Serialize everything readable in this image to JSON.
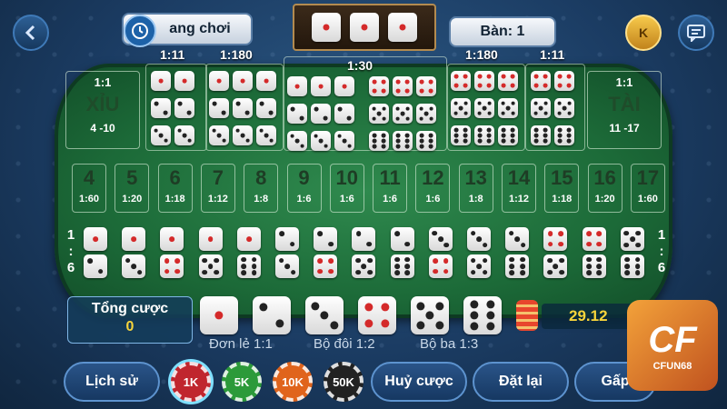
{
  "header": {
    "back_icon": "chevron-left-icon",
    "game_rules_label": "ang chơi",
    "table_label": "Bàn: 1",
    "coin_icon": "k-coin-icon",
    "chat_icon": "chat-icon"
  },
  "result_dice": [
    1,
    1,
    1
  ],
  "odds": {
    "single_triple": "1:11",
    "double_pair_left": "1:180",
    "any_triple": "1:30",
    "double_pair_right": "1:180",
    "single_triple_right": "1:11"
  },
  "small": {
    "ratio": "1:1",
    "label": "XỈU",
    "range": "4 -10"
  },
  "big": {
    "ratio": "1:1",
    "label": "TÀI",
    "range": "11 -17"
  },
  "sums": [
    {
      "n": "4",
      "r": "1:60"
    },
    {
      "n": "5",
      "r": "1:20"
    },
    {
      "n": "6",
      "r": "1:18"
    },
    {
      "n": "7",
      "r": "1:12"
    },
    {
      "n": "8",
      "r": "1:8"
    },
    {
      "n": "9",
      "r": "1:6"
    },
    {
      "n": "10",
      "r": "1:6"
    },
    {
      "n": "11",
      "r": "1:6"
    },
    {
      "n": "12",
      "r": "1:6"
    },
    {
      "n": "13",
      "r": "1:8"
    },
    {
      "n": "14",
      "r": "1:12"
    },
    {
      "n": "15",
      "r": "1:18"
    },
    {
      "n": "16",
      "r": "1:20"
    },
    {
      "n": "17",
      "r": "1:60"
    }
  ],
  "combo_odds_left": [
    "1",
    ":",
    "6"
  ],
  "combo_odds_right": [
    "1",
    ":",
    "6"
  ],
  "combos": [
    [
      1,
      2
    ],
    [
      1,
      3
    ],
    [
      1,
      4
    ],
    [
      1,
      5
    ],
    [
      1,
      6
    ],
    [
      2,
      3
    ],
    [
      2,
      4
    ],
    [
      2,
      5
    ],
    [
      2,
      6
    ],
    [
      3,
      4
    ],
    [
      3,
      5
    ],
    [
      3,
      6
    ],
    [
      4,
      5
    ],
    [
      4,
      6
    ],
    [
      5,
      6
    ]
  ],
  "total_bet": {
    "label": "Tổng cược",
    "value": "0"
  },
  "singles": [
    1,
    2,
    3,
    4,
    5,
    6
  ],
  "balance": "29.12",
  "legend": {
    "single": "Đơn lẻ 1:1",
    "double": "Bộ đôi 1:2",
    "triple": "Bộ ba 1:3"
  },
  "buttons": {
    "history": "Lịch sử",
    "cancel": "Huỷ cược",
    "reset": "Đặt lại",
    "double": "Gấp"
  },
  "chips": [
    {
      "label": "1K",
      "color": "#c0262e"
    },
    {
      "label": "5K",
      "color": "#2c9a3a"
    },
    {
      "label": "10K",
      "color": "#e0641c"
    },
    {
      "label": "50K",
      "color": "#222222"
    }
  ],
  "watermark": {
    "brand": "CFUN68"
  }
}
